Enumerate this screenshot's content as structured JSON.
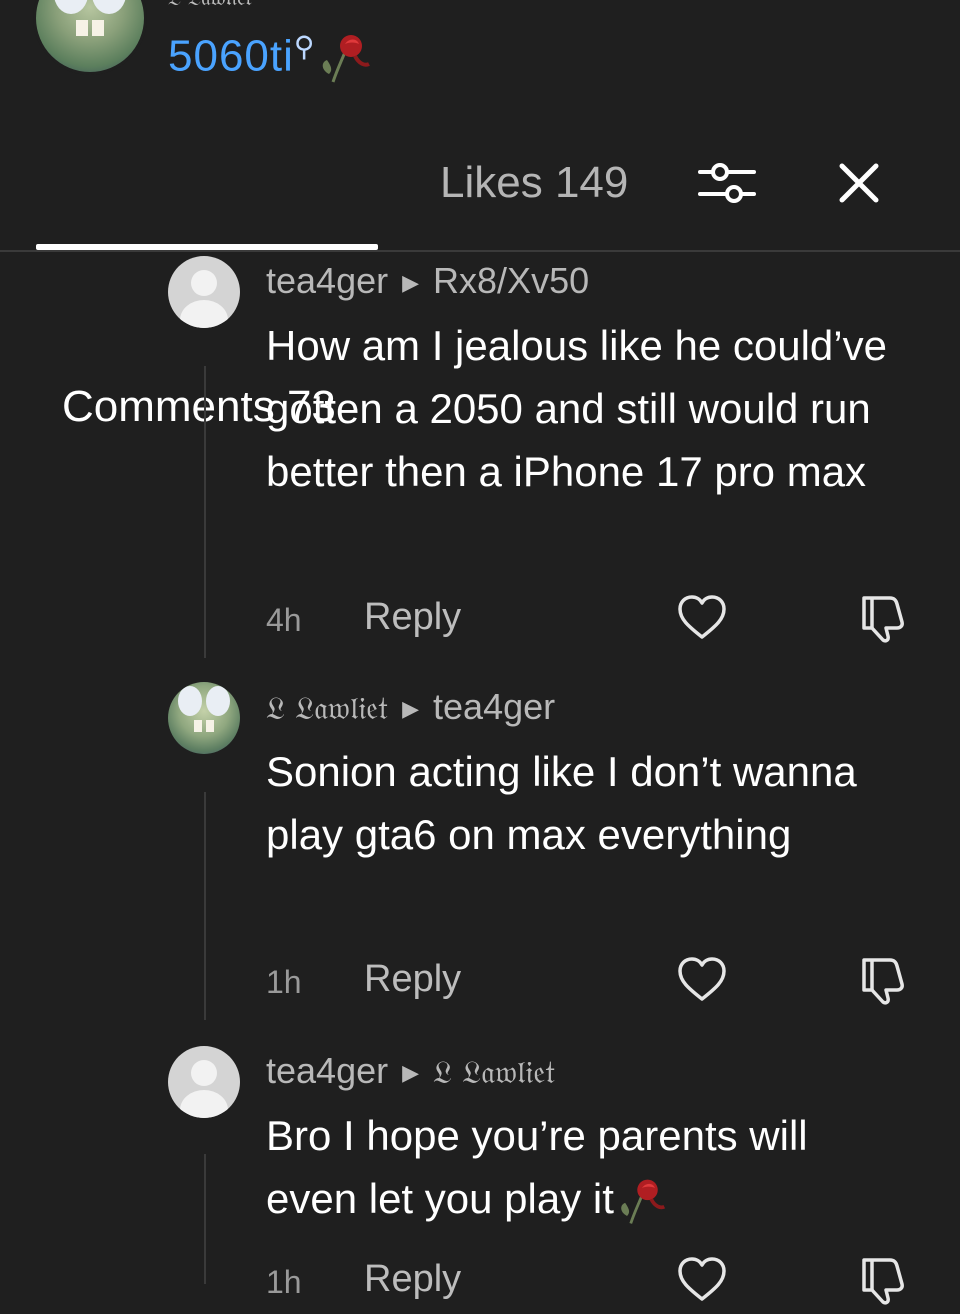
{
  "header": {
    "display_name": "𝔏 𝔏𝔞𝔴𝔩𝔦𝔢𝔱",
    "username": "5060ti",
    "username_suffix_icon": "magnifier-icon"
  },
  "tabs": {
    "comments_label": "Comments 73",
    "likes_label": "Likes 149",
    "active": "comments"
  },
  "comments": [
    {
      "author": "tea4ger",
      "reply_to": "Rx8/Xv50",
      "text": "How am I jealous like he could’ve gotten a 2050 and still would run better then a iPhone 17 pro max",
      "time": "4h",
      "reply_label": "Reply",
      "avatar": "default"
    },
    {
      "author": "𝔏 𝔏𝔞𝔴𝔩𝔦𝔢𝔱",
      "reply_to": "tea4ger",
      "text": "Sonion acting like I don’t wanna play gta6 on max everything",
      "time": "1h",
      "reply_label": "Reply",
      "avatar": "sponge"
    },
    {
      "author": "tea4ger",
      "reply_to": "𝔏 𝔏𝔞𝔴𝔩𝔦𝔢𝔱",
      "text": "Bro I hope you’re parents will even let you play it",
      "time": "1h",
      "reply_label": "Reply",
      "avatar": "default"
    }
  ],
  "colors": {
    "background": "#1f1f1f",
    "username_blue": "#4aa3ff",
    "text_primary": "#ffffff",
    "text_secondary": "#b8b8b8"
  }
}
